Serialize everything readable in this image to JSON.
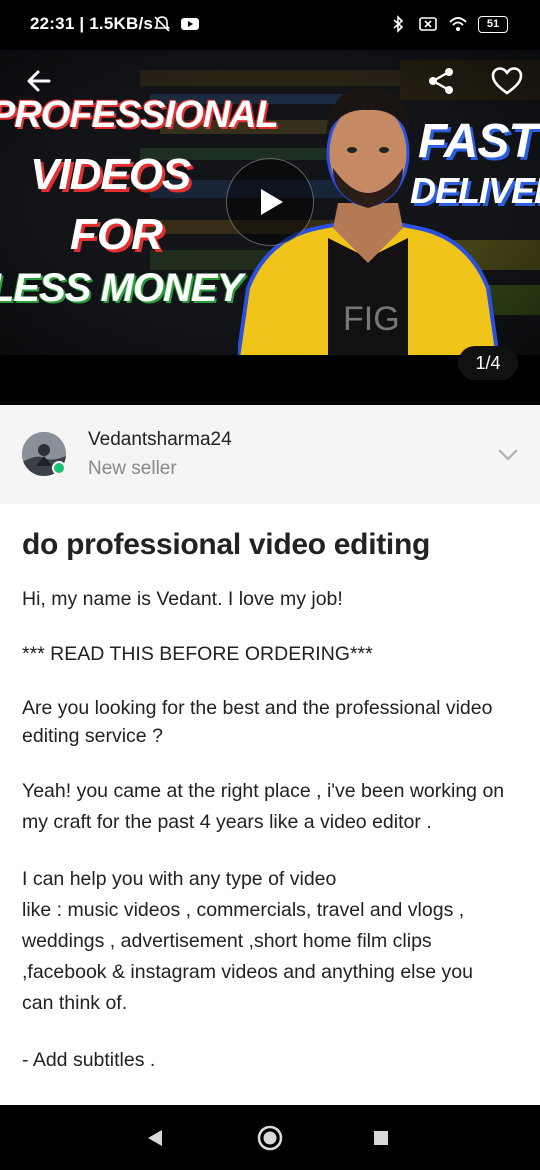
{
  "status_bar": {
    "time_speed": "22:31 | 1.5KB/s",
    "battery": "51"
  },
  "hero": {
    "thumbnail_lines": {
      "line1": "PROFESSIONAL",
      "line2": "VIDEOS",
      "line3": "FOR",
      "line4": "LESS MONEY",
      "line5": "FAST",
      "line6": "DELIVER"
    },
    "shirt_text": "FIG",
    "page_counter": "1/4",
    "icons": {
      "back": "arrow-left-icon",
      "share": "share-icon",
      "favorite": "heart-icon",
      "play": "play-icon"
    }
  },
  "seller": {
    "name": "Vedantsharma24",
    "level": "New seller",
    "online_color": "#1dbf73"
  },
  "gig": {
    "title": "do professional video editing",
    "description": [
      "Hi, my name is Vedant. I love my job!",
      "*** READ THIS BEFORE ORDERING***",
      "Are you looking for the best and the professional video editing service ?",
      "Yeah! you came at the right place , i've been working on my craft for the past 4 years like a video editor .",
      "I can help you with any type of video",
      "like : music videos , commercials, travel and vlogs , weddings , advertisement ,short home film clips ,facebook & instagram videos and anything else you can think of.",
      "- Add subtitles ."
    ]
  },
  "nav": {
    "back": "nav-back-icon",
    "home": "nav-home-icon",
    "recents": "nav-recents-icon"
  }
}
